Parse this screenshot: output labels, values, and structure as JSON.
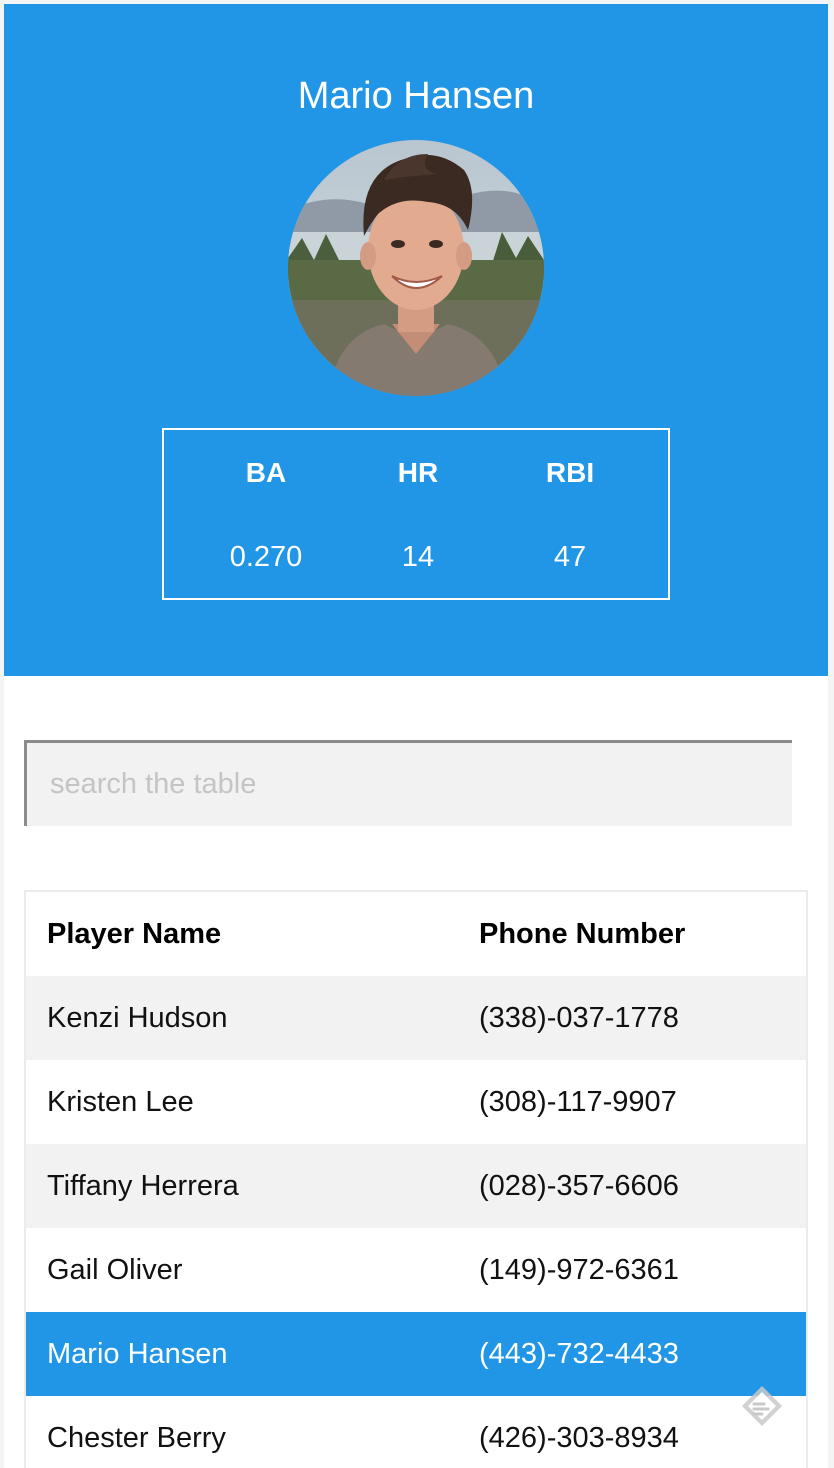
{
  "profile": {
    "name": "Mario Hansen",
    "stats": [
      {
        "label": "BA",
        "value": "0.270"
      },
      {
        "label": "HR",
        "value": "14"
      },
      {
        "label": "RBI",
        "value": "47"
      }
    ]
  },
  "search": {
    "placeholder": "search the table",
    "value": ""
  },
  "table": {
    "columns": [
      "Player Name",
      "Phone Number"
    ],
    "selected_index": 4,
    "rows": [
      {
        "name": "Kenzi Hudson",
        "phone": "(338)-037-1778"
      },
      {
        "name": "Kristen Lee",
        "phone": "(308)-117-9907"
      },
      {
        "name": "Tiffany Herrera",
        "phone": "(028)-357-6606"
      },
      {
        "name": "Gail Oliver",
        "phone": "(149)-972-6361"
      },
      {
        "name": "Mario Hansen",
        "phone": "(443)-732-4433"
      },
      {
        "name": "Chester Berry",
        "phone": "(426)-303-8934"
      }
    ]
  },
  "icons": {
    "avatar": "player-photo",
    "floating": "feedback-icon"
  },
  "colors": {
    "accent": "#2196e6",
    "row_alt": "#f2f2f2",
    "text": "#111111"
  }
}
